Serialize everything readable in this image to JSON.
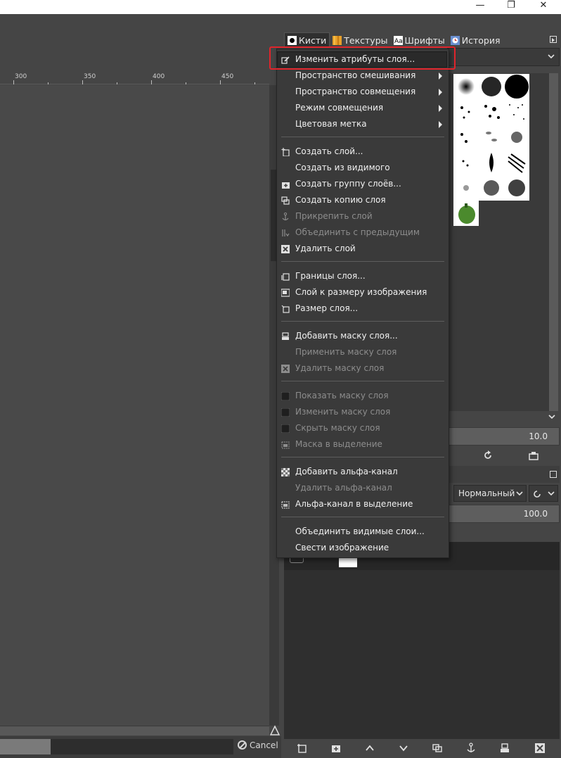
{
  "window": {
    "minimize_label": "—",
    "restore_label": "❐",
    "close_label": "✕"
  },
  "ruler": {
    "ticks": [
      "300",
      "350",
      "400",
      "450"
    ]
  },
  "status": {
    "cancel_label": "Cancel"
  },
  "dock": {
    "tabs": [
      {
        "label": "Кисти",
        "icon": "brush-icon"
      },
      {
        "label": "Текстуры",
        "icon": "pattern-icon"
      },
      {
        "label": "Шрифты",
        "icon": "font-icon"
      },
      {
        "label": "История",
        "icon": "history-icon"
      }
    ],
    "spacing_value": "10.0",
    "mode_value": "Нормальный",
    "opacity_value": "100.0"
  },
  "context_menu": {
    "items": [
      {
        "label": "Изменить атрибуты слоя...",
        "icon": "edit-attributes-icon",
        "enabled": true,
        "highlighted": true
      },
      {
        "label": "Пространство смешивания",
        "submenu": true,
        "enabled": true
      },
      {
        "label": "Пространство совмещения",
        "submenu": true,
        "enabled": true
      },
      {
        "label": "Режим совмещения",
        "submenu": true,
        "enabled": true
      },
      {
        "label": "Цветовая метка",
        "submenu": true,
        "enabled": true
      },
      {
        "label": "Создать слой...",
        "icon": "new-layer-icon",
        "enabled": true
      },
      {
        "label": "Создать из видимого",
        "enabled": true
      },
      {
        "label": "Создать группу слоёв...",
        "icon": "new-group-icon",
        "enabled": true
      },
      {
        "label": "Создать копию слоя",
        "icon": "duplicate-layer-icon",
        "enabled": true
      },
      {
        "label": "Прикрепить слой",
        "icon": "anchor-icon",
        "enabled": false
      },
      {
        "label": "Объединить с предыдущим",
        "icon": "merge-down-icon",
        "enabled": false
      },
      {
        "label": "Удалить слой",
        "icon": "delete-icon",
        "enabled": true
      },
      {
        "label": "Границы слоя...",
        "icon": "layer-boundary-icon",
        "enabled": true
      },
      {
        "label": "Слой к размеру изображения",
        "icon": "layer-to-image-icon",
        "enabled": true
      },
      {
        "label": "Размер слоя...",
        "icon": "scale-layer-icon",
        "enabled": true
      },
      {
        "label": "Добавить маску слоя...",
        "icon": "add-mask-icon",
        "enabled": true
      },
      {
        "label": "Применить маску слоя",
        "enabled": false
      },
      {
        "label": "Удалить маску слоя",
        "icon": "delete-mask-icon",
        "enabled": false
      },
      {
        "label": "Показать маску слоя",
        "icon": "checkbox-icon",
        "enabled": false
      },
      {
        "label": "Изменить маску слоя",
        "icon": "checkbox-icon",
        "enabled": false
      },
      {
        "label": "Скрыть маску слоя",
        "icon": "checkbox-icon",
        "enabled": false
      },
      {
        "label": "Маска в выделение",
        "icon": "mask-to-selection-icon",
        "enabled": false
      },
      {
        "label": "Добавить альфа-канал",
        "icon": "alpha-channel-icon",
        "enabled": true
      },
      {
        "label": "Удалить альфа-канал",
        "enabled": false
      },
      {
        "label": "Альфа-канал в выделение",
        "icon": "alpha-to-selection-icon",
        "enabled": true
      },
      {
        "label": "Объединить видимые слои...",
        "enabled": true
      },
      {
        "label": "Свести изображение",
        "enabled": true
      }
    ]
  }
}
